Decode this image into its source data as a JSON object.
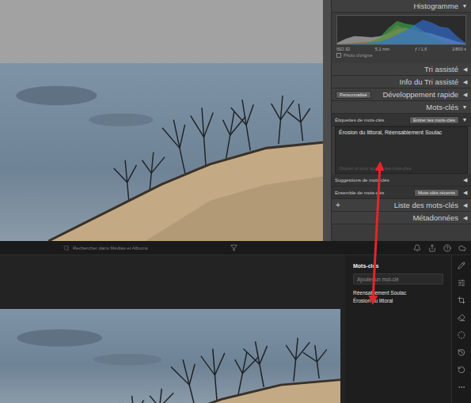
{
  "classic": {
    "histogram": {
      "title": "Histogramme",
      "toggle": "▼",
      "series": [
        {
          "name": "luminance",
          "color": "#bdbdbd",
          "values": [
            5,
            20,
            30,
            28,
            25,
            30,
            40,
            55,
            60,
            50,
            45,
            40,
            30,
            20,
            10,
            3
          ]
        },
        {
          "name": "red",
          "color": "#d0443c",
          "values": [
            0,
            2,
            5,
            8,
            10,
            20,
            45,
            70,
            55,
            60,
            40,
            25,
            10,
            5,
            2,
            0
          ]
        },
        {
          "name": "green",
          "color": "#3aa64a",
          "values": [
            0,
            2,
            4,
            6,
            10,
            25,
            60,
            85,
            75,
            70,
            50,
            30,
            15,
            5,
            2,
            0
          ]
        },
        {
          "name": "blue",
          "color": "#2f6fd6",
          "values": [
            0,
            0,
            2,
            4,
            6,
            10,
            20,
            35,
            50,
            70,
            90,
            80,
            65,
            60,
            30,
            5
          ]
        }
      ],
      "stats": [
        "ISO 32",
        "5,1 mm",
        "ƒ / 1,6",
        "1/800 s"
      ],
      "original_photo": {
        "label": "Photo d'origine",
        "checked": false
      }
    },
    "panels": [
      {
        "title": "Tri assisté",
        "toggle": "◀",
        "dropdown": ""
      },
      {
        "title": "Info du Tri assisté",
        "toggle": "◀",
        "dropdown": ""
      },
      {
        "title": "Développement rapide",
        "toggle": "◀",
        "dropdown": "Personnalisé"
      }
    ],
    "keywords": {
      "title": "Mots-clés",
      "toggle": "▼",
      "tagging_label": "Étiquettes de mots-clés",
      "tagging_mode": "Entrer les mots-clés",
      "tagging_toggle": "▼",
      "text": "Érosion du littoral, Réensablement Soulac",
      "placeholder": "Cliquez ici pour ajouter des mots-clés",
      "sections": [
        {
          "title": "Suggestions de mots-clés",
          "toggle": "◀",
          "dropdown": ""
        },
        {
          "title": "Ensemble de mots-clés",
          "toggle": "◀",
          "dropdown": "Mots-clés récents"
        }
      ]
    },
    "after": [
      {
        "prefix": "+",
        "title": "Liste des mots-clés",
        "toggle": "◀"
      },
      {
        "prefix": "",
        "title": "Métadonnées",
        "toggle": "◀"
      }
    ]
  },
  "cc": {
    "search": {
      "placeholder": "Rechercher dans Médias et Albums"
    },
    "keywords": {
      "title": "Mots-clés",
      "placeholder": "Ajouter un mot-clé",
      "items": [
        "Réensablement Soulac",
        "Érosion du littoral"
      ]
    }
  }
}
